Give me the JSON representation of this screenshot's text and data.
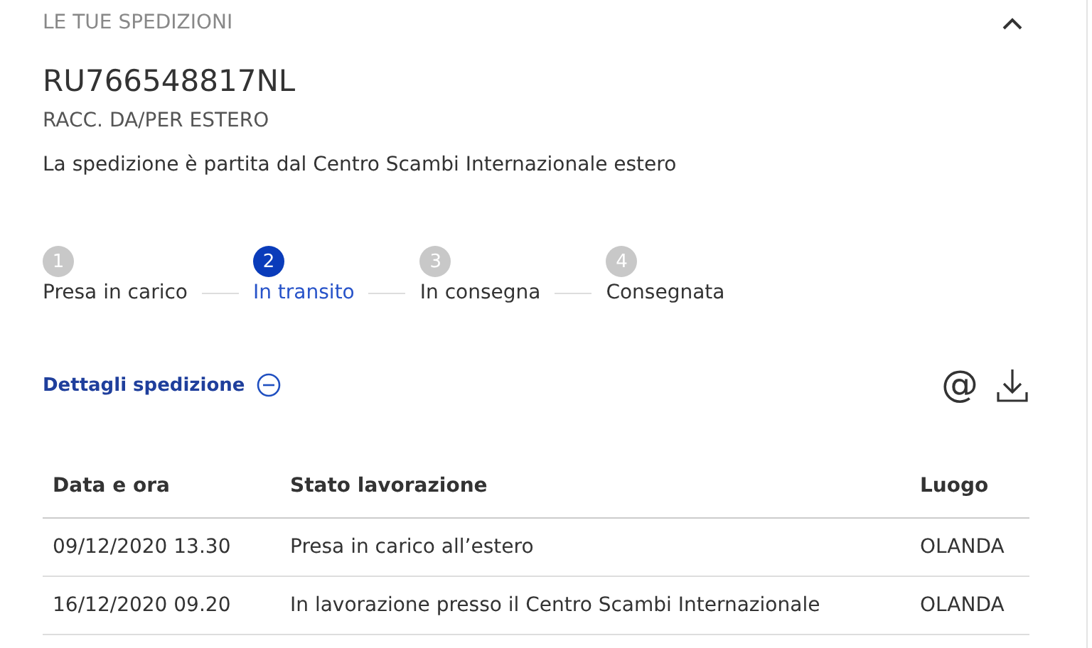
{
  "section": {
    "title": "LE TUE SPEDIZIONI",
    "expanded": true
  },
  "tracking_number": "RU766548817NL",
  "service": "RACC. DA/PER ESTERO",
  "status_message": "La spedizione è partita dal Centro Scambi Internazionale estero",
  "steps": [
    {
      "number": "1",
      "label": "Presa in carico",
      "selected": false
    },
    {
      "number": "2",
      "label": "In transito",
      "selected": true
    },
    {
      "number": "3",
      "label": "In consegna",
      "selected": false
    },
    {
      "number": "4",
      "label": "Consegnata",
      "selected": false
    }
  ],
  "details_toggle": {
    "label": "Dettagli spedizione",
    "expanded": true
  },
  "email_button": "@",
  "table": {
    "columns": [
      "Data e ora",
      "Stato lavorazione",
      "Luogo"
    ],
    "rows": [
      [
        "09/12/2020 13.30",
        "Presa in carico all’estero",
        "OLANDA"
      ],
      [
        "16/12/2020 09.20",
        "In lavorazione presso il Centro Scambi Internazionale",
        "OLANDA"
      ]
    ]
  }
}
